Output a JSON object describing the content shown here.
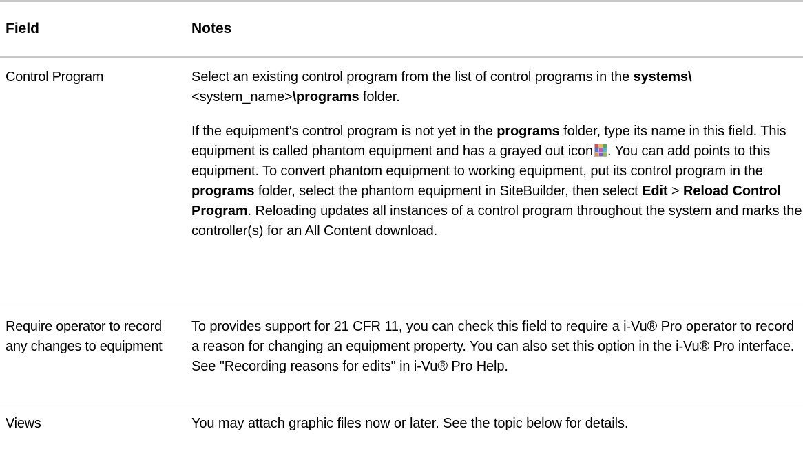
{
  "header": {
    "field": "Field",
    "notes": "Notes"
  },
  "rows": [
    {
      "field": "Control Program",
      "p1": {
        "a": "Select an existing control program from the list of control programs in the ",
        "b1": "systems\\",
        "c": "<system_name>",
        "b2": "\\programs",
        "d": " folder."
      },
      "p2": {
        "a": "If the equipment's control program is not yet in the ",
        "b1": "programs",
        "c": " folder, type its name in this field. This equipment is called phantom equipment and has a grayed out icon",
        "icon": "phantom-equipment-icon",
        "d": ". You can add points to this equipment. To convert phantom equipment to working equipment, put its control program in the ",
        "b2": "programs",
        "e": " folder, select the phantom equipment in SiteBuilder, then select ",
        "b3": "Edit",
        "f": " > ",
        "b4": "Reload Control Program",
        "g": ". Reloading updates all instances of a control program throughout the system and marks the controller(s) for an All Content download."
      }
    },
    {
      "field": "Require operator to record any changes to equipment",
      "notes": "To provides support for 21 CFR 11, you can check this field to require a i-Vu® Pro operator to record a reason for changing an equipment property. You can also set this option in the i-Vu® Pro interface. See \"Recording reasons for edits\" in i-Vu® Pro Help."
    },
    {
      "field": "Views",
      "notes": "You may attach graphic files now or later. See the topic below for details."
    }
  ],
  "colors": {
    "rule": "#c8c8c8",
    "text": "#000000"
  }
}
